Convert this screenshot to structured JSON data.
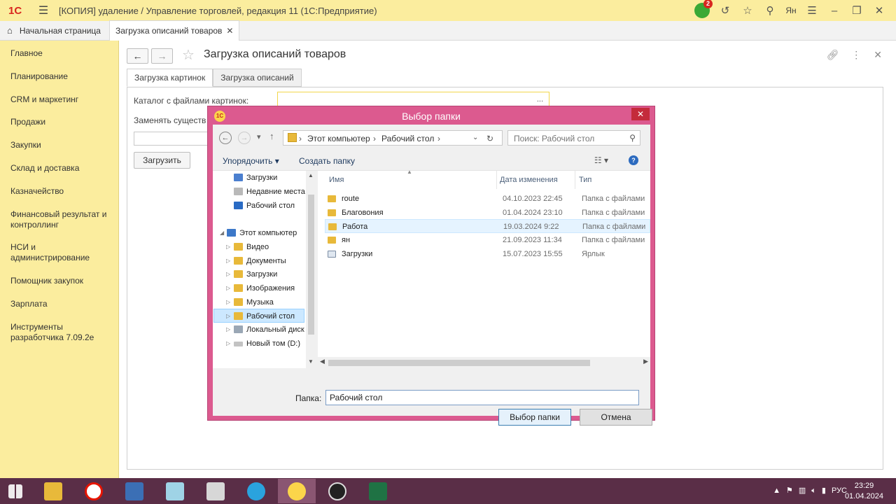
{
  "titlebar": {
    "logo": "1С",
    "title": "[КОПИЯ] удаление / Управление торговлей, редакция 11  (1С:Предприятие)",
    "notification_count": "2",
    "user": "Ян"
  },
  "tabs": {
    "home_label": "Начальная страница",
    "doc_label": "Загрузка описаний товаров"
  },
  "sidebar": {
    "items": [
      {
        "label": "Главное"
      },
      {
        "label": "Планирование"
      },
      {
        "label": "CRM и маркетинг"
      },
      {
        "label": "Продажи"
      },
      {
        "label": "Закупки"
      },
      {
        "label": "Склад и доставка"
      },
      {
        "label": "Казначейство"
      },
      {
        "label": "Финансовый результат и контроллинг"
      },
      {
        "label": "НСИ и администрирование"
      },
      {
        "label": "Помощник закупок"
      },
      {
        "label": "Зарплата"
      },
      {
        "label": "Инструменты разработчика 7.09.2е"
      }
    ]
  },
  "form": {
    "title": "Загрузка описаний товаров",
    "tabs": [
      "Загрузка картинок",
      "Загрузка описаний"
    ],
    "catalog_label": "Каталог с файлами картинок:",
    "replace_label": "Заменять существ",
    "load_button": "Загрузить"
  },
  "dialog": {
    "title": "Выбор папки",
    "breadcrumb": [
      "Этот компьютер",
      "Рабочий стол"
    ],
    "search_placeholder": "Поиск: Рабочий стол",
    "organize_label": "Упорядочить",
    "new_folder_label": "Создать папку",
    "help": "?",
    "tree": [
      {
        "label": "Загрузки",
        "icon": "downloads-folder-icon",
        "selected": false
      },
      {
        "label": "Недавние места",
        "icon": "recent-places-icon",
        "selected": false
      },
      {
        "label": "Рабочий стол",
        "icon": "desktop-icon",
        "selected": false
      },
      {
        "label": "Этот компьютер",
        "icon": "computer-icon",
        "selected": false
      },
      {
        "label": "Видео",
        "icon": "video-folder-icon",
        "selected": false
      },
      {
        "label": "Документы",
        "icon": "documents-folder-icon",
        "selected": false
      },
      {
        "label": "Загрузки",
        "icon": "downloads-folder-icon",
        "selected": false
      },
      {
        "label": "Изображения",
        "icon": "pictures-folder-icon",
        "selected": false
      },
      {
        "label": "Музыка",
        "icon": "music-folder-icon",
        "selected": false
      },
      {
        "label": "Рабочий стол",
        "icon": "desktop-folder-icon",
        "selected": true
      },
      {
        "label": "Локальный диск",
        "icon": "local-disk-icon",
        "selected": false
      },
      {
        "label": "Новый том (D:)",
        "icon": "drive-icon",
        "selected": false
      }
    ],
    "columns": {
      "name": "Имя",
      "date": "Дата изменения",
      "type": "Тип"
    },
    "files": [
      {
        "name": "route",
        "date": "04.10.2023 22:45",
        "type": "Папка с файлами"
      },
      {
        "name": "Благовония",
        "date": "01.04.2024 23:10",
        "type": "Папка с файлами"
      },
      {
        "name": "Работа",
        "date": "19.03.2024 9:22",
        "type": "Папка с файлами"
      },
      {
        "name": "ян",
        "date": "21.09.2023 11:34",
        "type": "Папка с файлами"
      },
      {
        "name": "Загрузки",
        "date": "15.07.2023 15:55",
        "type": "Ярлык"
      }
    ],
    "folder_label": "Папка:",
    "folder_value": "Рабочий стол",
    "select_button": "Выбор папки",
    "cancel_button": "Отмена"
  },
  "taskbar": {
    "lang": "РУС",
    "time": "23:29",
    "date": "01.04.2024"
  },
  "colors": {
    "yellow_bg": "#fbed9e",
    "dialog_border": "#dc5a8f",
    "taskbar": "#5a2e47"
  }
}
